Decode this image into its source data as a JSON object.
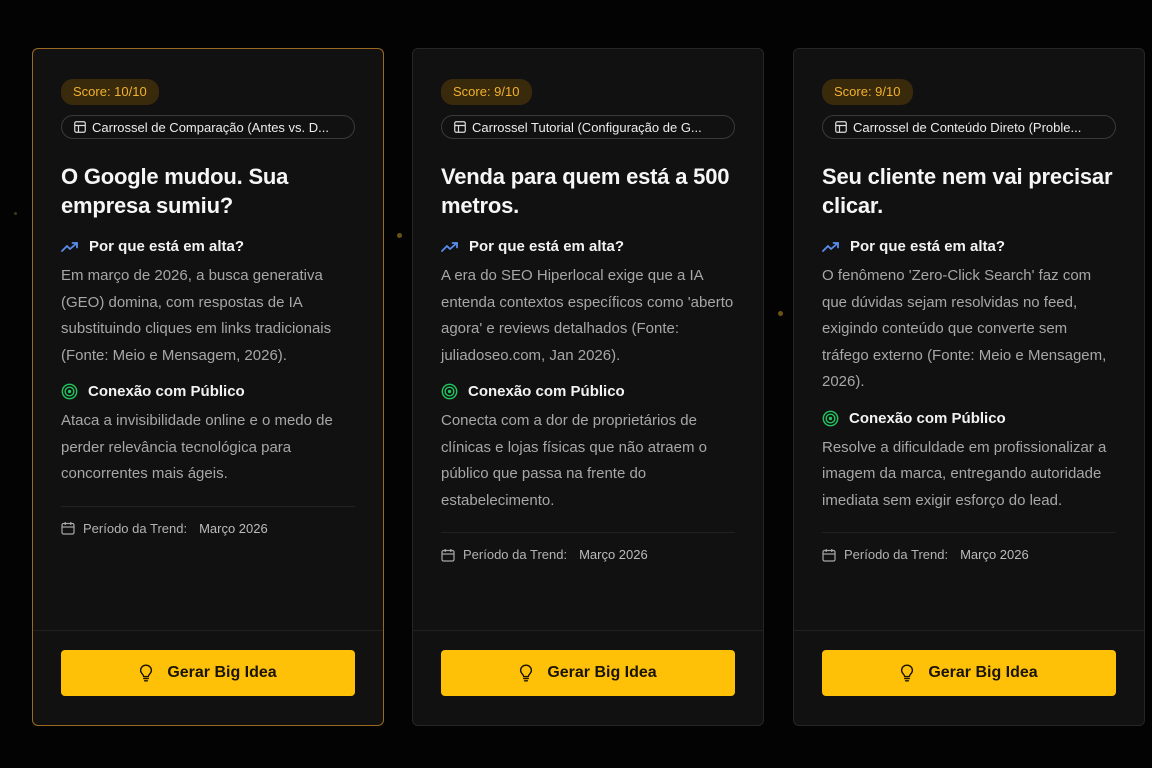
{
  "colors": {
    "accent": "#ffc107",
    "score_text": "#f2b12e",
    "trend_icon": "#5b8def",
    "target_icon": "#22c55e",
    "selected_border": "#9a6a22"
  },
  "icons": {
    "format": "layout-icon",
    "trend": "trending-up-icon",
    "audience": "target-icon",
    "period": "calendar-icon",
    "cta": "lightbulb-icon"
  },
  "cards": [
    {
      "score": "Score: 10/10",
      "format": "Carrossel de Comparação (Antes vs. D...",
      "headline": "O Google mudou. Sua empresa sumiu?",
      "why_title": "Por que está em alta?",
      "why_text": "Em março de 2026, a busca generativa (GEO) domina, com respostas de IA substituindo cliques em links tradicionais (Fonte: Meio e Mensagem, 2026).",
      "audience_title": "Conexão com Público",
      "audience_text": "Ataca a invisibilidade online e o medo de perder relevância tecnológica para concorrentes mais ágeis.",
      "period_label": "Período da Trend:",
      "period_value": "Março 2026",
      "cta": "Gerar Big Idea"
    },
    {
      "score": "Score: 9/10",
      "format": "Carrossel Tutorial (Configuração de G...",
      "headline": "Venda para quem está a 500 metros.",
      "why_title": "Por que está em alta?",
      "why_text": "A era do SEO Hiperlocal exige que a IA entenda contextos específicos como 'aberto agora' e reviews detalhados (Fonte: juliadoseo.com, Jan 2026).",
      "audience_title": "Conexão com Público",
      "audience_text": "Conecta com a dor de proprietários de clínicas e lojas físicas que não atraem o público que passa na frente do estabelecimento.",
      "period_label": "Período da Trend:",
      "period_value": "Março 2026",
      "cta": "Gerar Big Idea"
    },
    {
      "score": "Score: 9/10",
      "format": "Carrossel de Conteúdo Direto (Proble...",
      "headline": "Seu cliente nem vai precisar clicar.",
      "why_title": "Por que está em alta?",
      "why_text": "O fenômeno 'Zero-Click Search' faz com que dúvidas sejam resolvidas no feed, exigindo conteúdo que converte sem tráfego externo (Fonte: Meio e Mensagem, 2026).",
      "audience_title": "Conexão com Público",
      "audience_text": "Resolve a dificuldade em profissionalizar a imagem da marca, entregando autoridade imediata sem exigir esforço do lead.",
      "period_label": "Período da Trend:",
      "period_value": "Março 2026",
      "cta": "Gerar Big Idea"
    }
  ]
}
